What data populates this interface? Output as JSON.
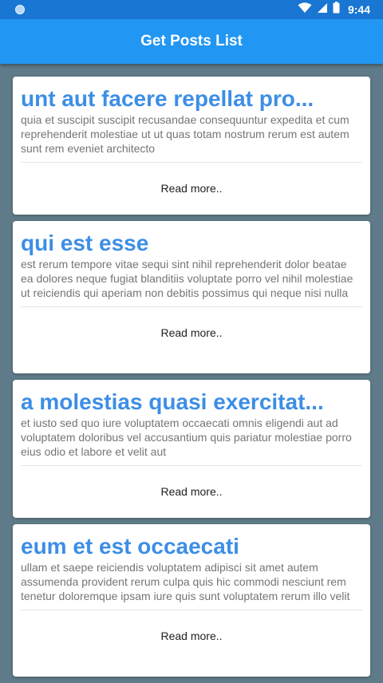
{
  "status_bar": {
    "time": "9:44",
    "icons": [
      "notification-dot-icon",
      "wifi-icon",
      "cellular-signal-icon",
      "battery-icon"
    ]
  },
  "app_bar": {
    "title": "Get Posts List"
  },
  "posts": [
    {
      "title": "unt aut facere repellat pro...",
      "body": "quia et suscipit suscipit recusandae consequuntur expedita et cum reprehenderit molestiae ut ut quas totam nostrum rerum est autem sunt rem eveniet architecto",
      "action": "Read more.."
    },
    {
      "title": "qui est esse",
      "body": "est rerum tempore vitae sequi sint nihil reprehenderit dolor beatae ea dolores neque fugiat blanditiis voluptate porro vel nihil molestiae ut reiciendis qui aperiam non debitis possimus qui neque nisi nulla",
      "action": "Read more.."
    },
    {
      "title": "a molestias quasi exercitat...",
      "body": "et iusto sed quo iure voluptatem occaecati omnis eligendi aut ad voluptatem doloribus vel accusantium quis pariatur molestiae porro eius odio et labore et velit aut",
      "action": "Read more.."
    },
    {
      "title": "eum et est occaecati",
      "body": "ullam et saepe reiciendis voluptatem adipisci sit amet autem assumenda provident rerum culpa quis hic commodi nesciunt rem tenetur doloremque ipsam iure quis sunt voluptatem rerum illo velit",
      "action": "Read more.."
    }
  ],
  "colors": {
    "status_bar": "#1976d2",
    "app_bar": "#2196f3",
    "background": "#5f7a88",
    "card_title": "#3d8ee6",
    "card_body": "#757575"
  }
}
